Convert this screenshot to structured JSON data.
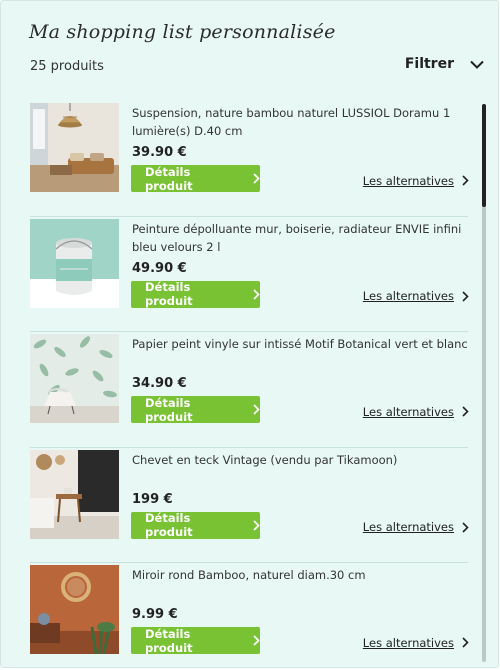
{
  "header": {
    "title": "Ma shopping list personnalisée",
    "count": "25 produits",
    "filter_label": "Filtrer"
  },
  "items": [
    {
      "name": "Suspension, nature bambou naturel LUSSIOL Doramu 1 lumière(s) D.40 cm",
      "price": "39.90 €",
      "details_label": "Détails produit",
      "alternatives_label": "Les alternatives",
      "image": "bamboo-pendant-lamp-living-room"
    },
    {
      "name": "Peinture dépolluante mur, boiserie, radiateur ENVIE infini bleu velours 2 l",
      "price": "49.90 €",
      "details_label": "Détails produit",
      "alternatives_label": "Les alternatives",
      "image": "paint-can-mint"
    },
    {
      "name": "Papier peint vinyle sur intissé Motif Botanical vert et blanc",
      "price": "34.90 €",
      "details_label": "Détails produit",
      "alternatives_label": "Les alternatives",
      "image": "botanical-wallpaper-room"
    },
    {
      "name": "Chevet en teck Vintage (vendu par Tikamoon)",
      "price": "199 €",
      "details_label": "Détails produit",
      "alternatives_label": "Les alternatives",
      "image": "teak-bedside-table-bedroom"
    },
    {
      "name": "Miroir rond Bamboo, naturel diam.30 cm",
      "price": "9.99 €",
      "details_label": "Détails produit",
      "alternatives_label": "Les alternatives",
      "image": "round-bamboo-mirror-terracotta-wall"
    }
  ],
  "colors": {
    "panel_bg": "#e8f8f5",
    "button_green": "#78c233",
    "divider": "#c9e2dc"
  }
}
